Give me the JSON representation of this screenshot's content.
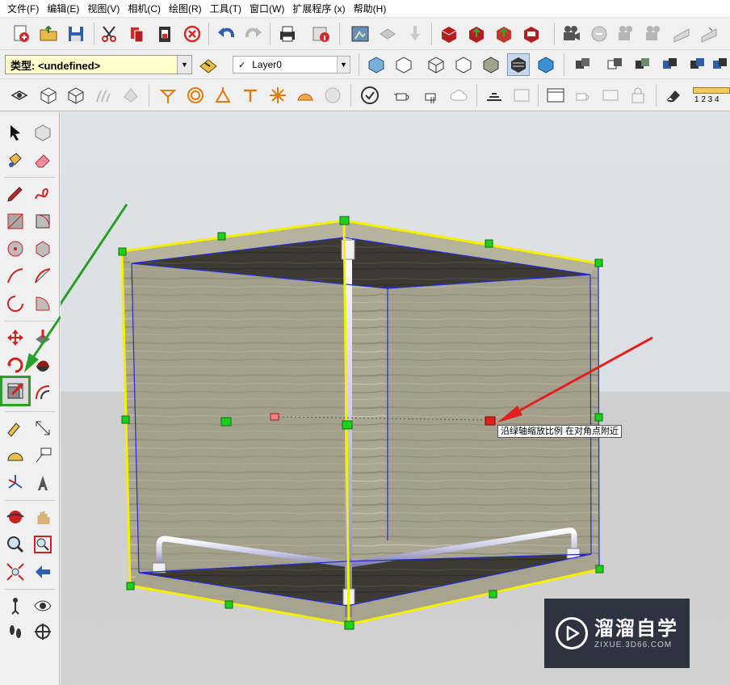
{
  "menu": {
    "items": [
      {
        "label": "文件(F)"
      },
      {
        "label": "编辑(E)"
      },
      {
        "label": "视图(V)"
      },
      {
        "label": "相机(C)"
      },
      {
        "label": "绘图(R)"
      },
      {
        "label": "工具(T)"
      },
      {
        "label": "窗口(W)"
      },
      {
        "label": "扩展程序 (x)"
      },
      {
        "label": "帮助(H)"
      }
    ]
  },
  "entity_info": {
    "type_value": "类型: <undefined>",
    "layer_value": "Layer0",
    "layer_checked_glyph": "✓",
    "dropdown_glyph": "▼"
  },
  "scale_bar": {
    "label": "1 2 3 4"
  },
  "viewport": {
    "tooltip": "沿绿轴缩放比例 在对角点附近",
    "active_tool": "scale-tool",
    "colors": {
      "selection_box": "#f4f000",
      "edge": "#1f2bd6",
      "grip_green": "#1bd21b",
      "grip_red": "#e02020",
      "annotation_green_arrow": "#2aa02a",
      "annotation_red_arrow": "#e32020"
    }
  },
  "watermark": {
    "title": "溜溜自学",
    "subtitle": "ZIXUE.3D66.COM"
  }
}
